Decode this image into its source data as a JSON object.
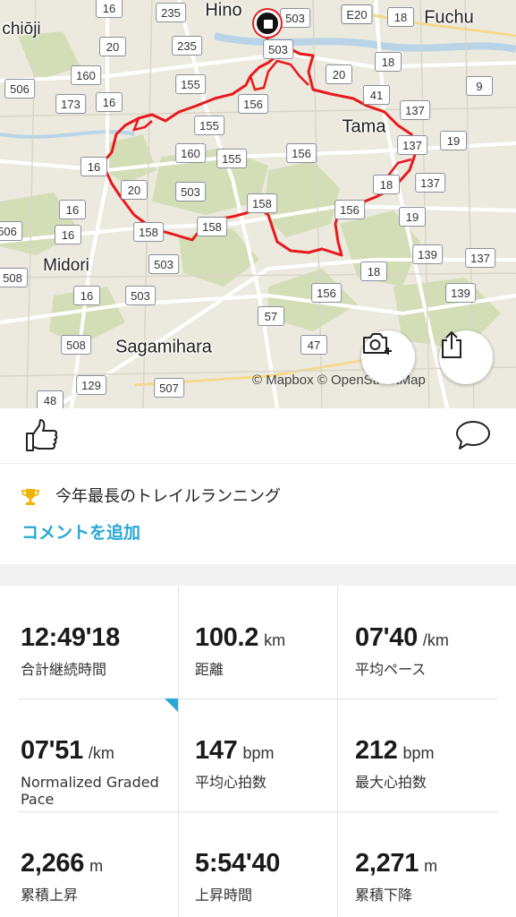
{
  "map": {
    "places": {
      "hino": "Hino",
      "fuchu": "Fuchu",
      "hachioji": "chiōji",
      "tama": "Tama",
      "midori": "Midori",
      "sagamihara": "Sagamihara"
    },
    "shields": [
      "16",
      "235",
      "503",
      "E20",
      "18",
      "20",
      "235",
      "506",
      "160",
      "173",
      "16",
      "155",
      "503",
      "156",
      "20",
      "41",
      "18",
      "9",
      "137",
      "155",
      "137",
      "19",
      "160",
      "155",
      "156",
      "16",
      "20",
      "503",
      "18",
      "137",
      "158",
      "156",
      "16",
      "158",
      "158",
      "19",
      "16",
      "506",
      "139",
      "137",
      "503",
      "18",
      "508",
      "16",
      "503",
      "156",
      "139",
      "57",
      "47",
      "508",
      "129",
      "507",
      "48"
    ],
    "attribution": "© Mapbox  © OpenStreetMap"
  },
  "actions": {
    "like_icon": "thumbs-up-icon",
    "comment_icon": "speech-bubble-icon"
  },
  "achievement": {
    "text": "今年最長のトレイルランニング",
    "add_comment": "コメントを追加"
  },
  "stats": {
    "duration": {
      "value": "12:49'18",
      "unit": "",
      "label": "合計継続時間"
    },
    "distance": {
      "value": "100.2",
      "unit": "km",
      "label": "距離"
    },
    "avg_pace": {
      "value": "07'40",
      "unit": "/km",
      "label": "平均ペース"
    },
    "ngp": {
      "value": "07'51",
      "unit": "/km",
      "label_line1": "Normalized Graded",
      "label_line2": "Pace"
    },
    "avg_hr": {
      "value": "147",
      "unit": "bpm",
      "label": "平均心拍数"
    },
    "max_hr": {
      "value": "212",
      "unit": "bpm",
      "label": "最大心拍数"
    },
    "ascent": {
      "value": "2,266",
      "unit": "m",
      "label": "累積上昇"
    },
    "ascent_time": {
      "value": "5:54'40",
      "unit": "",
      "label": "上昇時間"
    },
    "descent": {
      "value": "2,271",
      "unit": "m",
      "label": "累積下降"
    }
  },
  "colors": {
    "accent": "#2aa6d8",
    "route": "#e8191c",
    "trophy": "#f0b400"
  }
}
